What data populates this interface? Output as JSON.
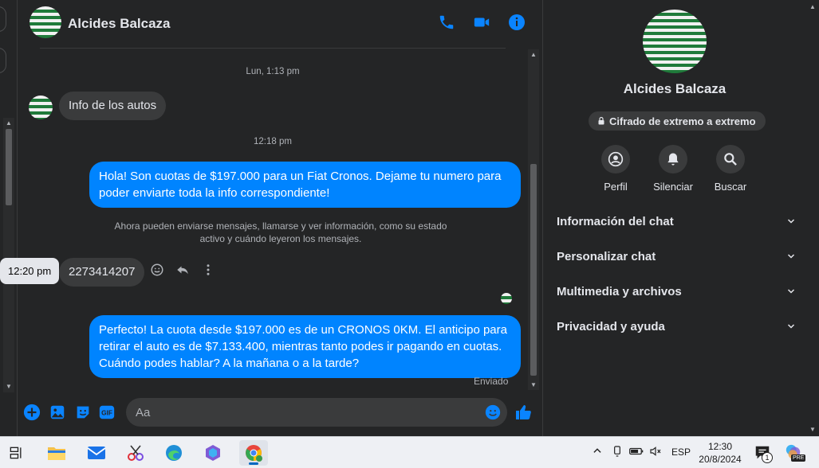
{
  "contact": {
    "name": "Alcides Balcaza"
  },
  "colors": {
    "accent": "#0084ff",
    "background": "#242526",
    "bubble_in": "#3a3b3c",
    "taskbar": "#eef0f4"
  },
  "header": {
    "name": "Alcides Balcaza",
    "icons": [
      "phone-icon",
      "video-icon",
      "info-icon"
    ]
  },
  "messages": {
    "timestamp1": "Lun, 1:13 pm",
    "msg1": "Info de los autos",
    "timestamp2": "12:18 pm",
    "msg2": "Hola! Son cuotas de $197.000 para un Fiat Cronos. Dejame tu numero para poder enviarte toda la info correspondiente!",
    "system_line1": "Ahora pueden enviarse mensajes, llamarse y ver información, como su estado",
    "system_line2": "activo y cuándo leyeron los mensajes.",
    "tooltip": "12:20 pm",
    "msg3": "2273414207",
    "msg4_line1": "Perfecto! La cuota desde $197.000 es de un CRONOS 0KM. El anticipo para",
    "msg4_line2": "retirar el auto es de $7.133.400, mientras tanto podes ir pagando en cuotas.",
    "msg4_line3": "Cuándo podes hablar? A la mañana o a la tarde?",
    "status": "Enviado"
  },
  "composer": {
    "placeholder": "Aa",
    "icons": [
      "plus-icon",
      "photo-icon",
      "sticker-icon",
      "gif-icon",
      "emoji-icon",
      "like-icon"
    ],
    "gif_label": "GIF"
  },
  "panel": {
    "name": "Alcides Balcaza",
    "e2e": "Cifrado de extremo a extremo",
    "actions": [
      {
        "label": "Perfil",
        "icon": "profile-icon"
      },
      {
        "label": "Silenciar",
        "icon": "bell-icon"
      },
      {
        "label": "Buscar",
        "icon": "search-icon"
      }
    ],
    "sections": [
      "Información del chat",
      "Personalizar chat",
      "Multimedia y archivos",
      "Privacidad y ayuda"
    ]
  },
  "taskbar": {
    "apps": [
      "task-view",
      "file-explorer",
      "mail",
      "snipping-tool",
      "edge",
      "copilot",
      "chrome"
    ],
    "language": "ESP",
    "time": "12:30",
    "date": "20/8/2024",
    "notification_count": "1",
    "pre_badge": "PRE"
  }
}
